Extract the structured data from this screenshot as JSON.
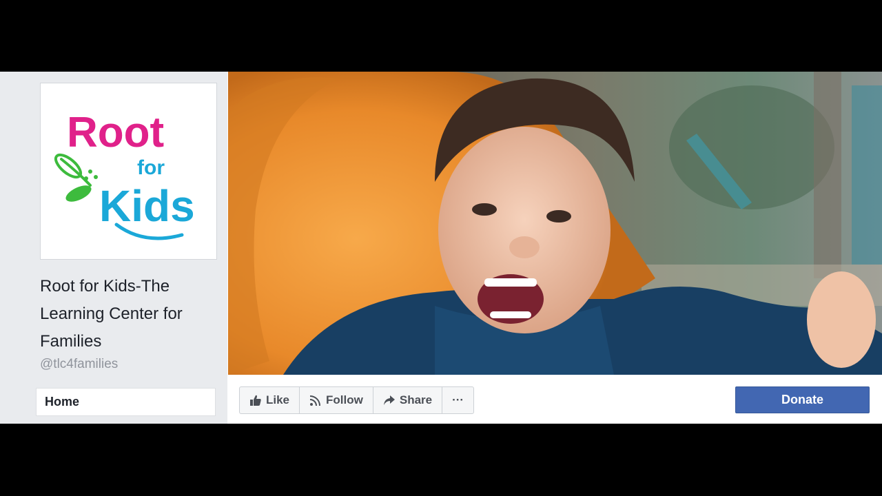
{
  "sidebar": {
    "logo": {
      "lines": [
        "Root",
        "for",
        "Kids"
      ],
      "colors": {
        "root": "#e0218a",
        "for": "#1ba8d8",
        "kids": "#1ba8d8",
        "leaf": "#3dbb3d"
      }
    },
    "page_name": "Root for Kids-The Learning Center for Families",
    "page_name_lines": [
      "Root for Kids-The",
      "Learning Center for",
      "Families"
    ],
    "handle": "@tlc4families",
    "nav": {
      "home": "Home"
    }
  },
  "cover": {
    "description_icon": "photo-cover",
    "accent": "#f08a24"
  },
  "actions": {
    "like": {
      "label": "Like",
      "icon": "thumbs-up-icon"
    },
    "follow": {
      "label": "Follow",
      "icon": "rss-icon"
    },
    "share": {
      "label": "Share",
      "icon": "share-arrow-icon"
    },
    "more": {
      "label": "···",
      "icon": "more-icon"
    }
  },
  "donate": {
    "label": "Donate",
    "color": "#4267b2"
  }
}
